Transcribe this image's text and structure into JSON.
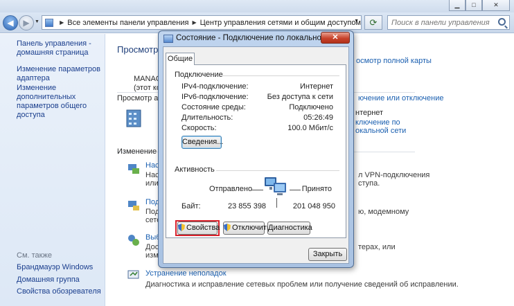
{
  "window": {
    "minimize": "▁",
    "maximize": "□",
    "close": "✕"
  },
  "address": {
    "crumbs": [
      "Все элементы панели управления",
      "Центр управления сетями и общим доступом"
    ],
    "search_placeholder": "Поиск в панели управления"
  },
  "sidebar": {
    "items": [
      "Панель управления - домашняя страница",
      "Изменение параметров адаптера",
      "Изменение дополнительных параметров общего доступа"
    ],
    "see_also_title": "См. также",
    "see_also": [
      "Брандмауэр Windows",
      "Домашняя группа",
      "Свойства обозревателя"
    ]
  },
  "main": {
    "heading": "Просмотр",
    "full_map_link": "осмотр полной карты",
    "computer_name": "MANAG",
    "computer_sub": "(этот комп",
    "active_heading": "Просмотр акти",
    "connect_link": "ючение или отключение",
    "internet_text": "нтернет",
    "lan_link": "ключение по",
    "lan_link2": "окальной сети",
    "change_heading": "Изменение сет",
    "items": [
      {
        "title": "Наст",
        "l1": "Наст",
        "l2": "или",
        "r1": "л VPN-подключения",
        "r2": "ступа."
      },
      {
        "title": "Подк",
        "l1": "Подк",
        "l2": "сете",
        "r1": "ю, модемному",
        "r2": ""
      },
      {
        "title": "Выб",
        "l1": "Дост",
        "l2": "изме",
        "r1": "терах, или",
        "r2": ""
      }
    ],
    "troubleshoot": "Устранение неполадок",
    "troubleshoot_desc": "Диагностика и исправление сетевых проблем или получение сведений об исправлении."
  },
  "dialog": {
    "title": "Состояние - Подключение по локальной сети",
    "tab": "Общие",
    "connection_group": "Подключение",
    "rows": [
      {
        "label": "IPv4-подключение:",
        "value": "Интернет"
      },
      {
        "label": "IPv6-подключение:",
        "value": "Без доступа к сети"
      },
      {
        "label": "Состояние среды:",
        "value": "Подключено"
      },
      {
        "label": "Длительность:",
        "value": "05:26:49"
      },
      {
        "label": "Скорость:",
        "value": "100.0 Мбит/с"
      }
    ],
    "details_button": "Сведения...",
    "activity_group": "Активность",
    "sent_label": "Отправлено",
    "received_label": "Принято",
    "bytes_label": "Байт:",
    "bytes_sent": "23 855 398",
    "bytes_received": "201 048 950",
    "properties_button": "Свойства",
    "disable_button": "Отключить",
    "diagnose_button": "Диагностика",
    "close_button": "Закрыть"
  }
}
